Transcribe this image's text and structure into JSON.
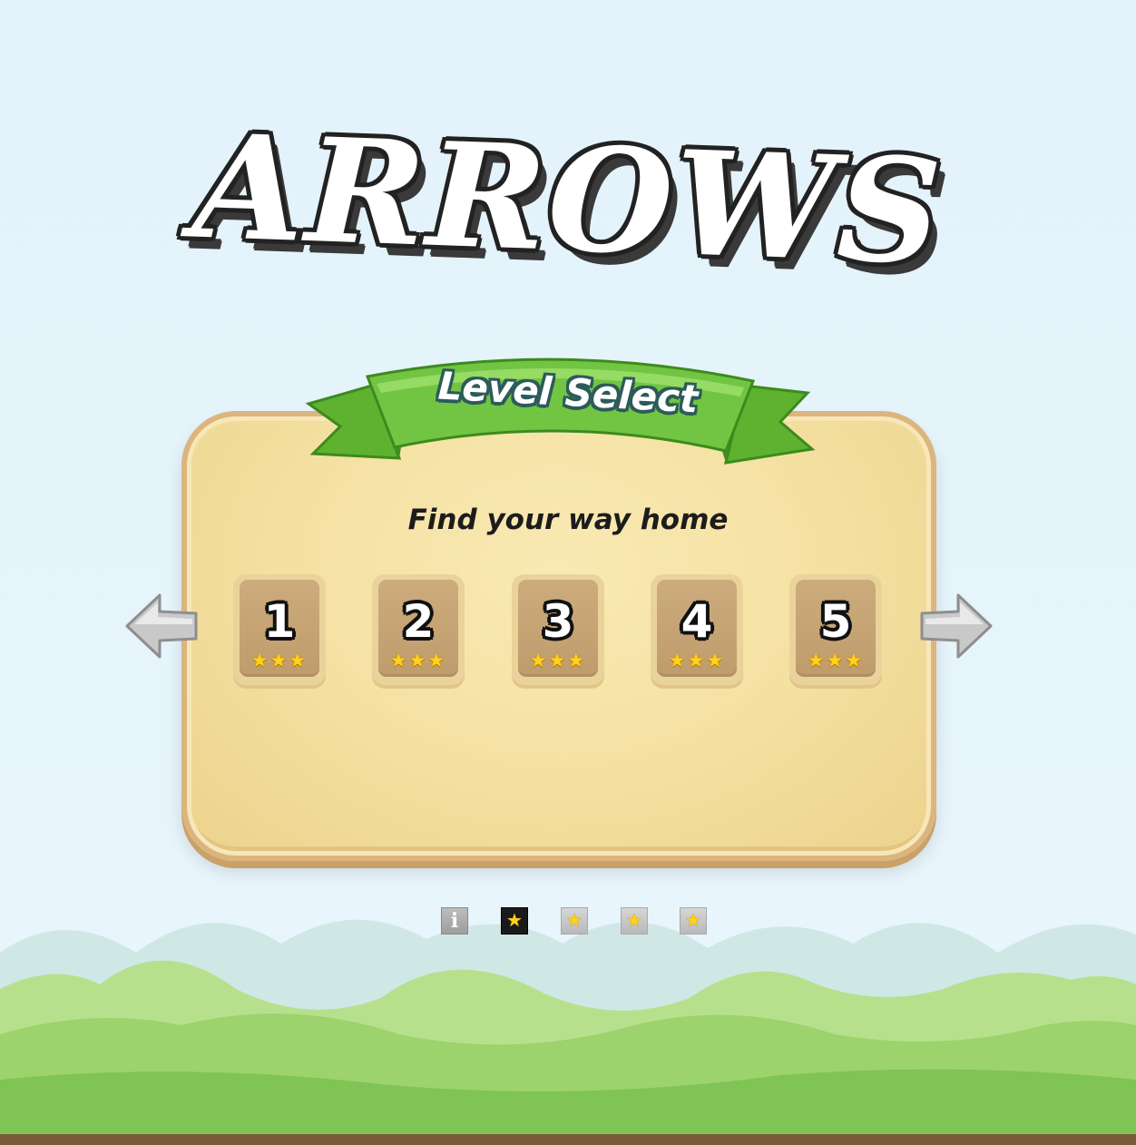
{
  "game": {
    "title": "ARROWS"
  },
  "panel": {
    "banner": "Level Select",
    "subtitle": "Find your way home"
  },
  "levels": [
    {
      "number": "1",
      "stars": "★★★",
      "star_count": 3
    },
    {
      "number": "2",
      "stars": "★★★",
      "star_count": 3
    },
    {
      "number": "3",
      "stars": "★★★",
      "star_count": 3
    },
    {
      "number": "4",
      "stars": "★★★",
      "star_count": 3
    },
    {
      "number": "5",
      "stars": "★★★",
      "star_count": 3
    }
  ],
  "navigation": {
    "prev_icon": "arrow-left-icon",
    "next_icon": "arrow-right-icon"
  },
  "pager": {
    "info_label": "i",
    "dots": [
      "★",
      "★",
      "★",
      "★"
    ],
    "active_index": 0
  },
  "colors": {
    "sky": "#e3f3fb",
    "panel": "#f5e2a4",
    "ribbon": "#72c542",
    "star": "#ffd21c",
    "grass": "#9bd56c"
  }
}
